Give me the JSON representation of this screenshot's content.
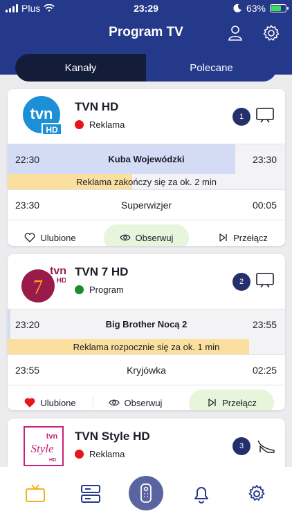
{
  "status_bar": {
    "carrier": "Plus",
    "time": "23:29",
    "battery": "63%"
  },
  "nav": {
    "title": "Program TV",
    "icons": [
      "user-icon",
      "gear-icon"
    ]
  },
  "tabs": [
    {
      "label": "Kanały",
      "active": true
    },
    {
      "label": "Polecane",
      "active": false
    }
  ],
  "channels": [
    {
      "name": "TVN HD",
      "logo_text": "tvn",
      "logo_sub": "HD",
      "status": "Reklama",
      "status_color": "#e8141c",
      "number": "1",
      "device_icon": "tv-icon",
      "current": {
        "start": "22:30",
        "title": "Kuba Wojewódzki",
        "end": "23:30",
        "progress": 0.82
      },
      "info": {
        "text": "Reklama zakończy się za ok. 2 min",
        "progress": 0.45
      },
      "next": {
        "start": "23:30",
        "title": "Superwizjer",
        "end": "00:05"
      },
      "actions": {
        "favorite": "Ulubione",
        "favorite_active": false,
        "watch": "Obserwuj",
        "switch": "Przełącz",
        "highlighted": "watch"
      }
    },
    {
      "name": "TVN 7 HD",
      "logo_text": "tvn",
      "logo_sub": "HD",
      "logo_glyph": "7",
      "status": "Program",
      "status_color": "#1e8c2c",
      "number": "2",
      "device_icon": "tv-icon",
      "current": {
        "start": "23:20",
        "title": "Big Brother Nocą 2",
        "end": "23:55",
        "progress": 0.01
      },
      "info": {
        "text": "Reklama rozpocznie się za ok. 1 min",
        "progress": 0.87
      },
      "next": {
        "start": "23:55",
        "title": "Kryjówka",
        "end": "02:25"
      },
      "actions": {
        "favorite": "Ulubione",
        "favorite_active": true,
        "watch": "Obserwuj",
        "switch": "Przełącz",
        "highlighted": "switch"
      }
    },
    {
      "name": "TVN Style HD",
      "logo_text": "tvn",
      "logo_glyph": "Style",
      "logo_sub": "HD",
      "status": "Reklama",
      "status_color": "#e8141c",
      "number": "3",
      "device_icon": "high-heel-icon"
    }
  ],
  "tabbar": {
    "items": [
      "tv-icon",
      "server-icon",
      "remote-icon",
      "bell-icon",
      "gear-icon"
    ],
    "active": "tv-icon"
  },
  "colors": {
    "header": "#24398a",
    "accent": "#24306b",
    "active_tab_icon": "#f2b21b"
  }
}
